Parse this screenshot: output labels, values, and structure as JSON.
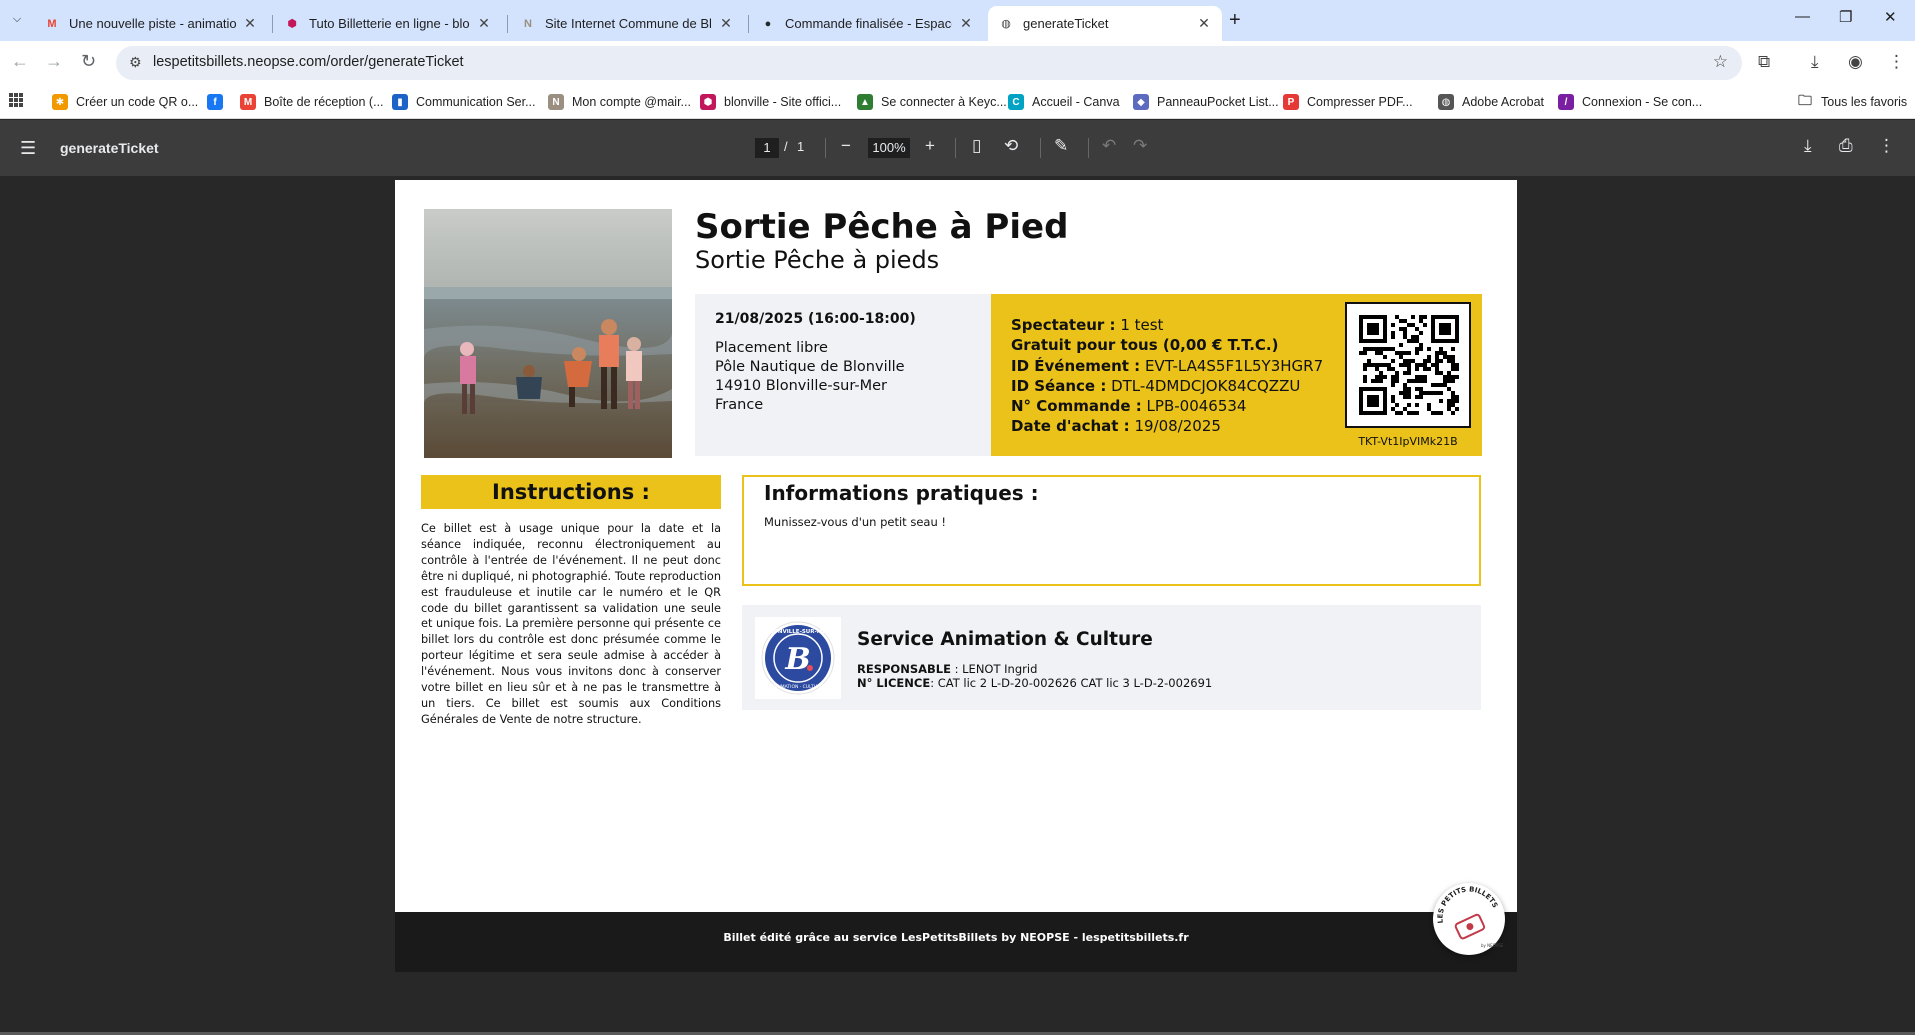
{
  "browser": {
    "tabs": [
      {
        "title": "Une nouvelle piste - animation",
        "icon": "gmail-icon",
        "active": false
      },
      {
        "title": "Tuto Billetterie en ligne - blonville",
        "icon": "blonville-icon",
        "active": false
      },
      {
        "title": "Site Internet Commune de Blonville",
        "icon": "notion-icon",
        "active": false
      },
      {
        "title": "Commande finalisée - Espace client",
        "icon": "github-icon",
        "active": false
      },
      {
        "title": "generateTicket",
        "icon": "globe-icon",
        "active": true
      }
    ],
    "url": "lespetitsbillets.neopse.com/order/generateTicket",
    "bookmarks": [
      {
        "label": "Créer un code QR o...",
        "icon": "gear-icon",
        "color": "#f29900"
      },
      {
        "label": "",
        "icon": "facebook-icon",
        "color": "#1877f2"
      },
      {
        "label": "Boîte de réception (...",
        "icon": "gmail-icon",
        "color": "#ea4335"
      },
      {
        "label": "Communication Ser...",
        "icon": "trello-icon",
        "color": "#1d63c7"
      },
      {
        "label": "Mon compte @mair...",
        "icon": "notion-icon",
        "color": "#9a8f80"
      },
      {
        "label": "blonville - Site offici...",
        "icon": "blonville-icon",
        "color": "#c2185b"
      },
      {
        "label": "Se connecter à Keyc...",
        "icon": "keycloak-icon",
        "color": "#2e7d32"
      },
      {
        "label": "Accueil - Canva",
        "icon": "canva-icon",
        "color": "#00a3c4"
      },
      {
        "label": "PanneauPocket List...",
        "icon": "panneaupocket-icon",
        "color": "#5c6bc0"
      },
      {
        "label": "Compresser PDF...",
        "icon": "pdf-icon",
        "color": "#e53935"
      },
      {
        "label": "Adobe Acrobat",
        "icon": "globe-icon",
        "color": "#555555"
      },
      {
        "label": "Connexion - Se con...",
        "icon": "feather-icon",
        "color": "#7b1fa2"
      }
    ],
    "all_bookmarks": "Tous les favoris"
  },
  "pdf_viewer": {
    "title": "generateTicket",
    "page_current": "1",
    "page_separator": "/",
    "page_total": "1",
    "zoom": "100%"
  },
  "ticket": {
    "event_title": "Sortie Pêche à Pied",
    "event_subtitle": "Sortie Pêche à pieds",
    "date": "21/08/2025 (16:00-18:00)",
    "placement": "Placement libre",
    "venue": "Pôle Nautique de Blonville",
    "postcode_city": "14910 Blonville-sur-Mer",
    "country": "France",
    "info": [
      {
        "label": "Spectateur :",
        "value": " 1 test",
        "label_bold": true
      },
      {
        "label": "Gratuit pour tous (0,00 € T.T.C.)",
        "value": "",
        "label_bold": true
      },
      {
        "label": "ID Événement :",
        "value": " EVT-LA4S5F1L5Y3HGR7",
        "label_bold": true
      },
      {
        "label": "ID Séance :",
        "value": " DTL-4DMDCJOK84CQZZU",
        "label_bold": true
      },
      {
        "label": "N° Commande :",
        "value": " LPB-0046534",
        "label_bold": true
      },
      {
        "label": "Date d'achat :",
        "value": " 19/08/2025",
        "label_bold": true
      }
    ],
    "ticket_code": "TKT-Vt1IpVIMk21B",
    "instructions_title": "Instructions :",
    "instructions_text": "Ce billet est à usage unique pour la date et la séance indiquée, reconnu électroniquement au contrôle à l'entrée de l'événement. Il ne peut donc être ni dupliqué, ni photographié. Toute reproduction est frauduleuse et inutile car le numéro et le QR code du billet garantissent sa validation une seule et unique fois. La première personne qui présente ce billet lors du contrôle est donc présumée comme le porteur légitime et sera seule admise à accéder à l'événement. Nous vous invitons donc à conserver votre billet en lieu sûr et à ne pas le transmettre à un tiers. Ce billet est soumis aux Conditions Générales de Vente de notre structure.",
    "practical_title": "Informations pratiques :",
    "practical_text": "Munissez-vous d'un petit seau !",
    "organizer_name": "Service Animation & Culture",
    "responsible_label": "RESPONSABLE",
    "responsible_value": " : LENOT Ingrid",
    "licence_label": "N° LICENCE",
    "licence_value": ": CAT lic 2 L-D-20-002626 CAT lic 3 L-D-2-002691",
    "footer": "Billet édité grâce au service LesPetitsBillets by NEOPSE - lespetitsbillets.fr",
    "accent_color": "#eac21a"
  }
}
